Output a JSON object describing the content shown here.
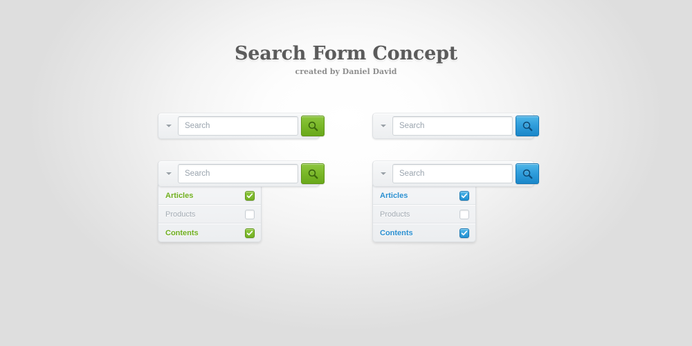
{
  "header": {
    "title": "Search Form Concept",
    "subtitle": "created by Daniel David"
  },
  "colors": {
    "green_accent": "#7ab828",
    "green_label": "#6fae1e",
    "blue_accent": "#2f9ddb",
    "blue_label": "#2b8fd0",
    "muted_label": "#a4acb4",
    "page_background": "#e4e4e4",
    "frame_background": "#f2f3f5"
  },
  "icons": {
    "caret": "chevron-down-icon",
    "search": "magnifier-icon",
    "check": "checkmark-icon"
  },
  "search": {
    "placeholder": "Search",
    "value": ""
  },
  "forms": [
    {
      "id": "green-collapsed",
      "theme": "green",
      "expanded": false,
      "placeholder": "Search",
      "value": ""
    },
    {
      "id": "blue-collapsed",
      "theme": "blue",
      "expanded": false,
      "placeholder": "Search",
      "value": ""
    },
    {
      "id": "green-expanded",
      "theme": "green",
      "expanded": true,
      "placeholder": "Search",
      "value": "",
      "options": [
        {
          "label": "Articles",
          "checked": true
        },
        {
          "label": "Products",
          "checked": false
        },
        {
          "label": "Contents",
          "checked": true
        }
      ]
    },
    {
      "id": "blue-expanded",
      "theme": "blue",
      "expanded": true,
      "placeholder": "Search",
      "value": "",
      "options": [
        {
          "label": "Articles",
          "checked": true
        },
        {
          "label": "Products",
          "checked": false
        },
        {
          "label": "Contents",
          "checked": true
        }
      ]
    }
  ]
}
